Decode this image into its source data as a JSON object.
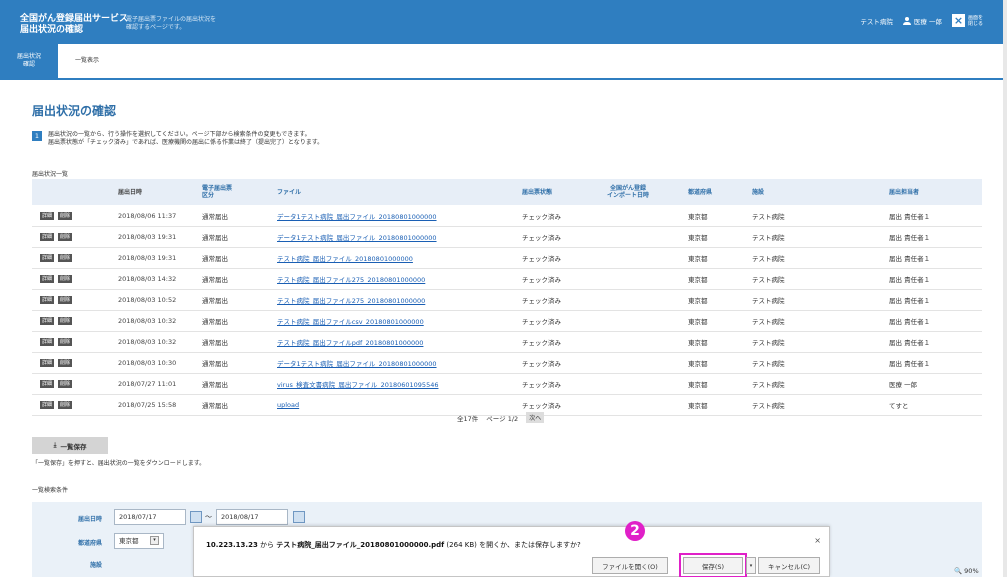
{
  "header": {
    "brand_line1": "全国がん登録届出サービス",
    "brand_line2": "届出状況の確認",
    "desc_line1": "電子届出票ファイルの届出状況を",
    "desc_line2": "確認するページです。",
    "hospital": "テスト病院",
    "user": "医療 一郎",
    "close_line1": "画面を",
    "close_line2": "閉じる"
  },
  "tabs": {
    "active_line1": "届出状況",
    "active_line2": "確認",
    "list": "一覧表示"
  },
  "page_title": "届出状況の確認",
  "info": {
    "number": "1",
    "line1": "届出状況の一覧から、行う操作を選択してください。ページ下部から検索条件の変更もできます。",
    "line2": "届出票状態が「チェック済み」であれば、医療機関の届出に係る作業は終了（提出完了）となります。"
  },
  "list_heading": "届出状況一覧",
  "table": {
    "headers": {
      "date": "届出日時",
      "kind_line1": "電子届出票",
      "kind_line2": "区分",
      "file": "ファイル",
      "status": "届出票状態",
      "import_line1": "全国がん登録",
      "import_line2": "インポート日時",
      "pref": "都道府県",
      "facility": "施設",
      "reporter": "届出担当者"
    },
    "detail_label": "詳細",
    "delete_label": "削除",
    "rows": [
      {
        "date": "2018/08/06 11:37",
        "kind": "通常届出",
        "file": "データ1テスト病院_届出ファイル_20180801000000",
        "status": "チェック済み",
        "pref": "東京都",
        "facility": "テスト病院",
        "reporter": "届出 責任者１"
      },
      {
        "date": "2018/08/03 19:31",
        "kind": "通常届出",
        "file": "データ1テスト病院_届出ファイル_20180801000000",
        "status": "チェック済み",
        "pref": "東京都",
        "facility": "テスト病院",
        "reporter": "届出 責任者１"
      },
      {
        "date": "2018/08/03 19:31",
        "kind": "通常届出",
        "file": "テスト病院_届出ファイル_20180801000000",
        "status": "チェック済み",
        "pref": "東京都",
        "facility": "テスト病院",
        "reporter": "届出 責任者１"
      },
      {
        "date": "2018/08/03 14:32",
        "kind": "通常届出",
        "file": "テスト病院_届出ファイル275_20180801000000",
        "status": "チェック済み",
        "pref": "東京都",
        "facility": "テスト病院",
        "reporter": "届出 責任者１"
      },
      {
        "date": "2018/08/03 10:52",
        "kind": "通常届出",
        "file": "テスト病院_届出ファイル275_20180801000000",
        "status": "チェック済み",
        "pref": "東京都",
        "facility": "テスト病院",
        "reporter": "届出 責任者１"
      },
      {
        "date": "2018/08/03 10:32",
        "kind": "通常届出",
        "file": "テスト病院_届出ファイルcsv_20180801000000",
        "status": "チェック済み",
        "pref": "東京都",
        "facility": "テスト病院",
        "reporter": "届出 責任者１"
      },
      {
        "date": "2018/08/03 10:32",
        "kind": "通常届出",
        "file": "テスト病院_届出ファイルpdf_20180801000000",
        "status": "チェック済み",
        "pref": "東京都",
        "facility": "テスト病院",
        "reporter": "届出 責任者１"
      },
      {
        "date": "2018/08/03 10:30",
        "kind": "通常届出",
        "file": "データ1テスト病院_届出ファイル_20180801000000",
        "status": "チェック済み",
        "pref": "東京都",
        "facility": "テスト病院",
        "reporter": "届出 責任者１"
      },
      {
        "date": "2018/07/27 11:01",
        "kind": "通常届出",
        "file": "virus_検査文書病院_届出ファイル_20180601095546",
        "status": "チェック済み",
        "pref": "東京都",
        "facility": "テスト病院",
        "reporter": "医療 一郎"
      },
      {
        "date": "2018/07/25 15:58",
        "kind": "通常届出",
        "file": "upload",
        "status": "チェック済み",
        "pref": "東京都",
        "facility": "テスト病院",
        "reporter": "てすと"
      }
    ]
  },
  "pager": {
    "total": "全17件",
    "page": "ページ 1/2",
    "next": "次へ"
  },
  "bulk_save": {
    "label": "一覧保存",
    "note": "「一覧保存」を押すと、届出状況の一覧をダウンロードします。"
  },
  "search": {
    "heading": "一覧検索条件",
    "date_label": "届出日時",
    "date_from": "2018/07/17",
    "tilde": "～",
    "date_to": "2018/08/17",
    "pref_label": "都道府県",
    "pref_value": "東京都",
    "facility_label": "施設"
  },
  "download_bar": {
    "host": "10.223.13.23",
    "from_text": " から ",
    "filename": "テスト病院_届出ファイル_20180801000000.pdf",
    "size": " (264 KB) ",
    "question": "を開くか、または保存しますか?",
    "open_label": "ファイルを開く(O)",
    "save_label": "保存(S)",
    "cancel_label": "キャンセル(C)"
  },
  "step_badge": "2",
  "zoom": "90%",
  "colors": {
    "accent": "#2f7ec0",
    "highlight": "#e020c8"
  }
}
